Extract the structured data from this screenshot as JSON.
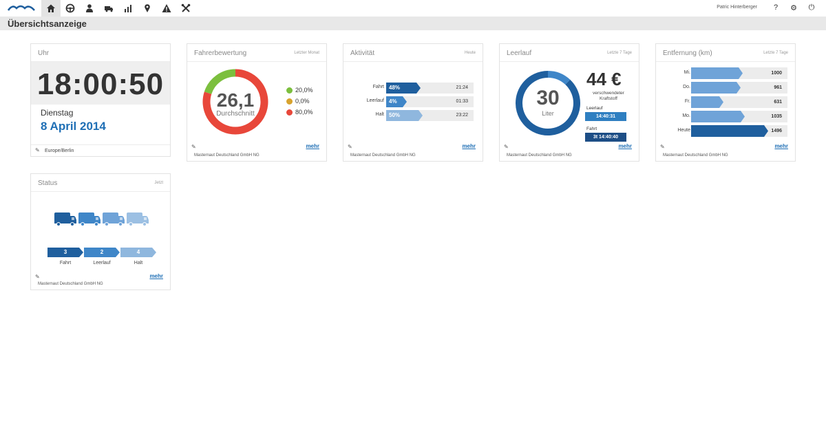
{
  "header": {
    "user_name": "Patric Hinterberger",
    "nav": [
      "home-icon",
      "steering-icon",
      "driver-icon",
      "truck-icon",
      "bar-chart-icon",
      "map-pin-icon",
      "warning-icon",
      "tools-icon"
    ],
    "icons": [
      "help-icon",
      "gear-icon",
      "power-icon"
    ]
  },
  "page": {
    "title": "Übersichtsanzeige"
  },
  "colors": {
    "blue_dark": "#1f5f9e",
    "blue_mid": "#3f86c8",
    "blue_light": "#8fb7de",
    "red": "#e8473a",
    "green": "#7cbf3e",
    "yellow": "#d8a32e",
    "accent_text": "#1f6fb5"
  },
  "common": {
    "company": "Masternaut Deutschland GmbH NG",
    "more": "mehr"
  },
  "clock": {
    "title": "Uhr",
    "time": "18:00:50",
    "weekday": "Dienstag",
    "date": "8 April 2014",
    "timezone": "Europe/Berlin"
  },
  "rating": {
    "title": "Fahrerbewertung",
    "range": "Letzter Monat",
    "value": "26,1",
    "caption": "Durchschnitt",
    "legend": [
      {
        "label": "20,0%",
        "color": "#7cbf3e",
        "fraction": 0.2
      },
      {
        "label": "0,0%",
        "color": "#d8a32e",
        "fraction": 0.0
      },
      {
        "label": "80,0%",
        "color": "#e8473a",
        "fraction": 0.8
      }
    ]
  },
  "activity": {
    "title": "Aktivität",
    "range": "Heute",
    "rows": [
      {
        "label": "Fahrt",
        "pct": "48%",
        "fraction": 0.48,
        "time": "21:24",
        "color": "#1f5f9e"
      },
      {
        "label": "Leerlauf",
        "pct": "4%",
        "fraction": 0.04,
        "time": "01:33",
        "color": "#3f86c8"
      },
      {
        "label": "Halt",
        "pct": "50%",
        "fraction": 0.5,
        "time": "23:22",
        "color": "#8fb7de"
      }
    ]
  },
  "idle": {
    "title": "Leerlauf",
    "range": "Letzte 7 Tage",
    "liters": "30",
    "unit": "Liter",
    "fraction": 0.12,
    "amount": "44 €",
    "amount_caption_1": "verschwendeter",
    "amount_caption_2": "Kraftstoff",
    "idle_label": "Leerlauf",
    "idle_time": "14:40:31",
    "drive_label": "Fahrt",
    "drive_time": "3t 14:40:40"
  },
  "distance": {
    "title": "Entfernung (km)",
    "range": "Letzte 7 Tage",
    "max": 1600,
    "rows": [
      {
        "label": "Mi.",
        "value": 1000,
        "display": "1000",
        "color": "#6fa3d8"
      },
      {
        "label": "Do.",
        "value": 961,
        "display": "961",
        "color": "#6fa3d8"
      },
      {
        "label": "Fr.",
        "value": 631,
        "display": "631",
        "color": "#6fa3d8"
      },
      {
        "label": "Mo.",
        "value": 1035,
        "display": "1035",
        "color": "#6fa3d8"
      },
      {
        "label": "Heute",
        "value": 1496,
        "display": "1496",
        "color": "#1f5f9e"
      }
    ]
  },
  "status": {
    "title": "Status",
    "range": "Jetzt",
    "trucks": [
      "#1f5f9e",
      "#3f86c8",
      "#6fa3d8",
      "#9cc0e3"
    ],
    "stages": [
      {
        "count": "3",
        "label": "Fahrt",
        "color": "#1f5f9e"
      },
      {
        "count": "2",
        "label": "Leerlauf",
        "color": "#3f86c8"
      },
      {
        "count": "4",
        "label": "Halt",
        "color": "#8fb7de"
      }
    ]
  }
}
